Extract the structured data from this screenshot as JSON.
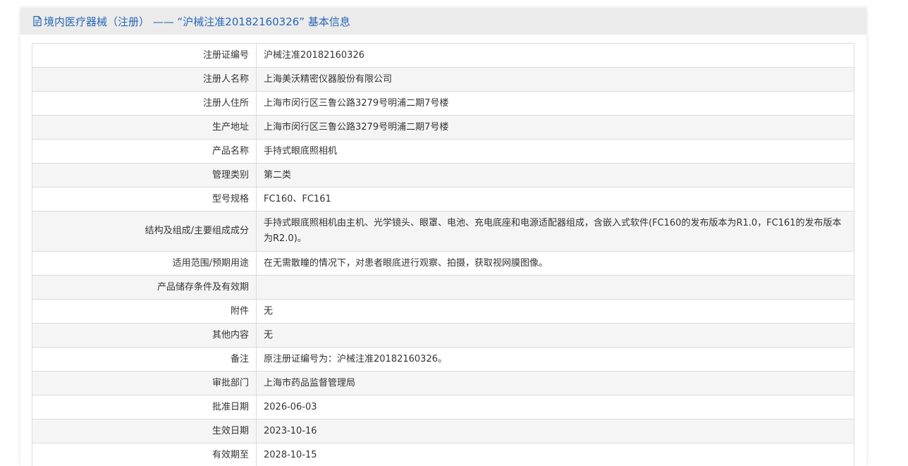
{
  "header": {
    "title": "境内医疗器械（注册） —— “沪械注准20182160326” 基本信息",
    "icon": "document-icon",
    "accent_color": "#2867b6"
  },
  "table": {
    "rows": [
      {
        "label": "注册证编号",
        "value": "沪械注准20182160326"
      },
      {
        "label": "注册人名称",
        "value": "上海美沃精密仪器股份有限公司"
      },
      {
        "label": "注册人住所",
        "value": "上海市闵行区三鲁公路3279号明浦二期7号楼"
      },
      {
        "label": "生产地址",
        "value": "上海市闵行区三鲁公路3279号明浦二期7号楼"
      },
      {
        "label": "产品名称",
        "value": "手持式眼底照相机"
      },
      {
        "label": "管理类别",
        "value": "第二类"
      },
      {
        "label": "型号规格",
        "value": "FC160、FC161"
      },
      {
        "label": "结构及组成/主要组成成分",
        "value": "手持式眼底照相机由主机、光学镜头、眼罩、电池、充电底座和电源适配器组成，含嵌入式软件(FC160的发布版本为R1.0，FC161的发布版本为R2.0)。"
      },
      {
        "label": "适用范围/预期用途",
        "value": "在无需散瞳的情况下，对患者眼底进行观察、拍摄，获取视网膜图像。"
      },
      {
        "label": "产品储存条件及有效期",
        "value": ""
      },
      {
        "label": "附件",
        "value": "无"
      },
      {
        "label": "其他内容",
        "value": "无"
      },
      {
        "label": "备注",
        "value": "原注册证编号为：沪械注准20182160326。"
      },
      {
        "label": "审批部门",
        "value": "上海市药品监督管理局"
      },
      {
        "label": "批准日期",
        "value": "2026-06-03"
      },
      {
        "label": "生效日期",
        "value": "2023-10-16"
      },
      {
        "label": "有效期至",
        "value": "2028-10-15"
      }
    ]
  }
}
